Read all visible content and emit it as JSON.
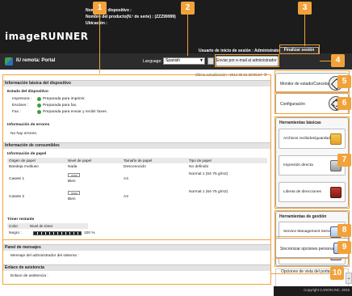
{
  "header": {
    "logo": "imageRUNNER",
    "device_name_label": "Nombre de dispositivo :",
    "product_name_label": "Nombre del producto(N.º de serie) : (ZZZ99999)",
    "location_label": "Ubicación :",
    "login_label": "Usuario de inicio de sesión : Administrator",
    "logout_label": "Finalizar sesión"
  },
  "appbar": {
    "title": "IU remota: Portal",
    "language_label": "Language:",
    "language_value": "Spanish",
    "mail_link": "Enviar por e-mail al administrador del sistema"
  },
  "main": {
    "last_updated": "Última actualización : 2014 05 21 23:05:57",
    "device_info_header": "Información básica del dispositivo",
    "device_status_title": "Estado del dispositivo",
    "status_rows": [
      {
        "label": "Impresora :",
        "value": "Preparada para imprimir."
      },
      {
        "label": "Escáner :",
        "value": "Preparada para fax."
      },
      {
        "label": "Fax :",
        "value": "Preparada para enviar y recibir faxes."
      }
    ],
    "error_title": "Información de errores",
    "error_value": "No hay errores.",
    "consumables_header": "Información de consumibles",
    "paper_title": "Información de papel",
    "paper_columns": [
      "Origen de papel",
      "Nivel de papel",
      "Tamaño de papel",
      "Tipo de papel"
    ],
    "paper_rows": [
      {
        "source": "Bandeja multiuso",
        "level": "Nada",
        "size": "Desconocido",
        "type": "No definido"
      },
      {
        "source": "Casete 1",
        "level": "Bien",
        "size": "A4",
        "type": "Normal 1 (64-75 g/m2)"
      },
      {
        "source": "Casete 2",
        "level": "Bien",
        "size": "A4",
        "type": "Normal 1 (64-75 g/m2)"
      }
    ],
    "toner_title": "Tóner restante",
    "toner_columns": [
      "Color",
      "Nivel de tóner"
    ],
    "toner_color": "Negro :",
    "toner_level": "100 %",
    "messages_header": "Panel de mensajes",
    "messages_value": "Mensaje del administrador del sistema :",
    "support_header": "Enlace de asistencia",
    "support_value": "Enlace de asistencia :"
  },
  "sidebar": {
    "status_monitor": "Monitor de estado/Cancelar",
    "settings": "Configuración",
    "basic_tools_title": "Herramientas básicas",
    "basic_tools": [
      "Archivos recibidos/guardados",
      "Impresión directa",
      "Libreta de direcciones"
    ],
    "mgmt_tools_title": "Herramientas de gestión",
    "mgmt_tools": [
      "Service Management Service",
      "User Setting Information Management Service"
    ],
    "sync_settings": "Sincronizar opciones personalizadas",
    "portal_options": "Opciones de vista del portal"
  },
  "footer": {
    "copyright": "Copyright CANON INC. 2019"
  },
  "markers": [
    "1",
    "2",
    "3",
    "4",
    "5",
    "6",
    "7",
    "8",
    "9",
    "10"
  ],
  "colors": {
    "marker": "#f2a23a",
    "status_ok": "#3aa043",
    "header_bg": "#1c1c1c"
  }
}
